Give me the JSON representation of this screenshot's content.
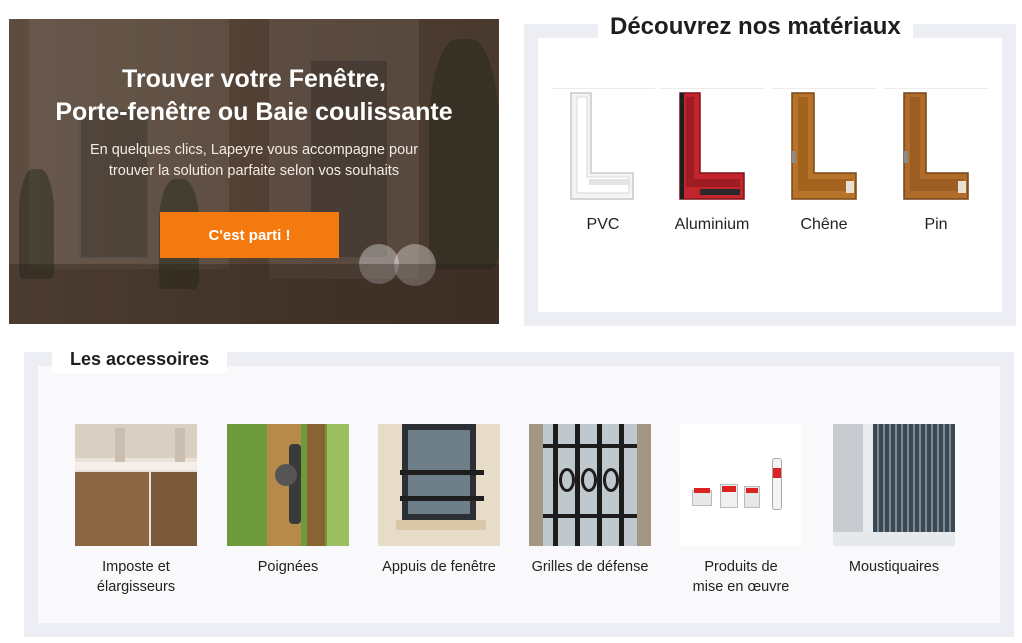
{
  "hero": {
    "title_line1": "Trouver votre Fenêtre,",
    "title_line2": "Porte-fenêtre ou Baie coulissante",
    "text_line1": "En quelques clics, Lapeyre vous accompagne pour",
    "text_line2": "trouver la solution parfaite selon vos souhaits",
    "button_label": "C'est parti !",
    "accent_color": "#f47a0f"
  },
  "materials": {
    "title": "Découvrez nos matériaux",
    "items": [
      {
        "label": "PVC",
        "color": "#f2f2f2",
        "icon": "pvc-profile-icon"
      },
      {
        "label": "Aluminium",
        "color": "#c4252c",
        "icon": "aluminium-profile-icon"
      },
      {
        "label": "Chêne",
        "color": "#b8732a",
        "icon": "oak-profile-icon"
      },
      {
        "label": "Pin",
        "color": "#b06c2a",
        "icon": "pine-profile-icon"
      }
    ]
  },
  "accessories": {
    "title": "Les accessoires",
    "items": [
      {
        "line1": "Imposte et",
        "line2": "élargisseurs"
      },
      {
        "line1": "Poignées",
        "line2": ""
      },
      {
        "line1": "Appuis de fenêtre",
        "line2": ""
      },
      {
        "line1": "Grilles de défense",
        "line2": ""
      },
      {
        "line1": "Produits de",
        "line2": "mise en œuvre"
      },
      {
        "line1": "Moustiquaires",
        "line2": ""
      }
    ]
  }
}
